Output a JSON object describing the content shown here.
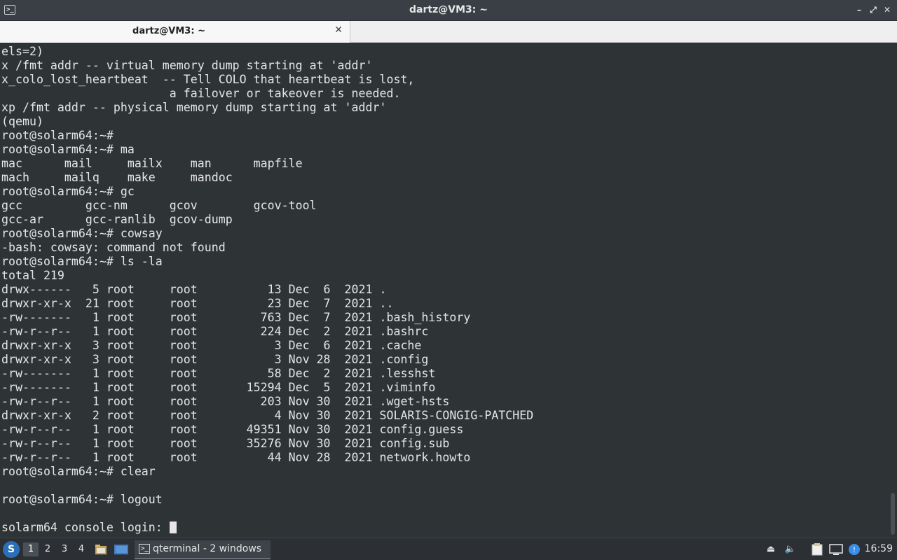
{
  "window": {
    "title": "dartz@VM3: ~",
    "controls": {
      "minimize": "–",
      "maximize": "⤢",
      "close": "✕"
    }
  },
  "tabs": [
    {
      "label": "dartz@VM3: ~",
      "close": "✕"
    }
  ],
  "terminal": {
    "lines": [
      "els=2)",
      "x /fmt addr -- virtual memory dump starting at 'addr'",
      "x_colo_lost_heartbeat  -- Tell COLO that heartbeat is lost,",
      "                        a failover or takeover is needed.",
      "xp /fmt addr -- physical memory dump starting at 'addr'",
      "(qemu)",
      "root@solarm64:~#",
      "root@solarm64:~# ma",
      "mac      mail     mailx    man      mapfile",
      "mach     mailq    make     mandoc",
      "root@solarm64:~# gc",
      "gcc         gcc-nm      gcov        gcov-tool",
      "gcc-ar      gcc-ranlib  gcov-dump",
      "root@solarm64:~# cowsay",
      "-bash: cowsay: command not found",
      "root@solarm64:~# ls -la",
      "total 219",
      "drwx------   5 root     root          13 Dec  6  2021 .",
      "drwxr-xr-x  21 root     root          23 Dec  7  2021 ..",
      "-rw-------   1 root     root         763 Dec  7  2021 .bash_history",
      "-rw-r--r--   1 root     root         224 Dec  2  2021 .bashrc",
      "drwxr-xr-x   3 root     root           3 Dec  6  2021 .cache",
      "drwxr-xr-x   3 root     root           3 Nov 28  2021 .config",
      "-rw-------   1 root     root          58 Dec  2  2021 .lesshst",
      "-rw-------   1 root     root       15294 Dec  5  2021 .viminfo",
      "-rw-r--r--   1 root     root         203 Nov 30  2021 .wget-hsts",
      "drwxr-xr-x   2 root     root           4 Nov 30  2021 SOLARIS-CONGIG-PATCHED",
      "-rw-r--r--   1 root     root       49351 Nov 30  2021 config.guess",
      "-rw-r--r--   1 root     root       35276 Nov 30  2021 config.sub",
      "-rw-r--r--   1 root     root          44 Nov 28  2021 network.howto",
      "root@solarm64:~# clear",
      "",
      "root@solarm64:~# logout",
      ""
    ],
    "prompt_line": "solarm64 console login: "
  },
  "taskbar": {
    "start_icon": "S",
    "workspaces": [
      "1",
      "2",
      "3",
      "4"
    ],
    "active_workspace": "1",
    "launchers": [
      "file-manager-icon",
      "desktop-icon"
    ],
    "task": {
      "label": "qterminal - 2 windows",
      "icon": ">_"
    },
    "tray": [
      "eject-icon",
      "volume-icon",
      "clipboard-icon",
      "network-icon",
      "updates-icon"
    ],
    "clock": "16:59"
  },
  "colors": {
    "terminal_bg": "#2e3436",
    "terminal_fg": "#e6e6e6",
    "titlebar_bg": "#3a3f45",
    "taskbar_bg": "#2c3034"
  }
}
